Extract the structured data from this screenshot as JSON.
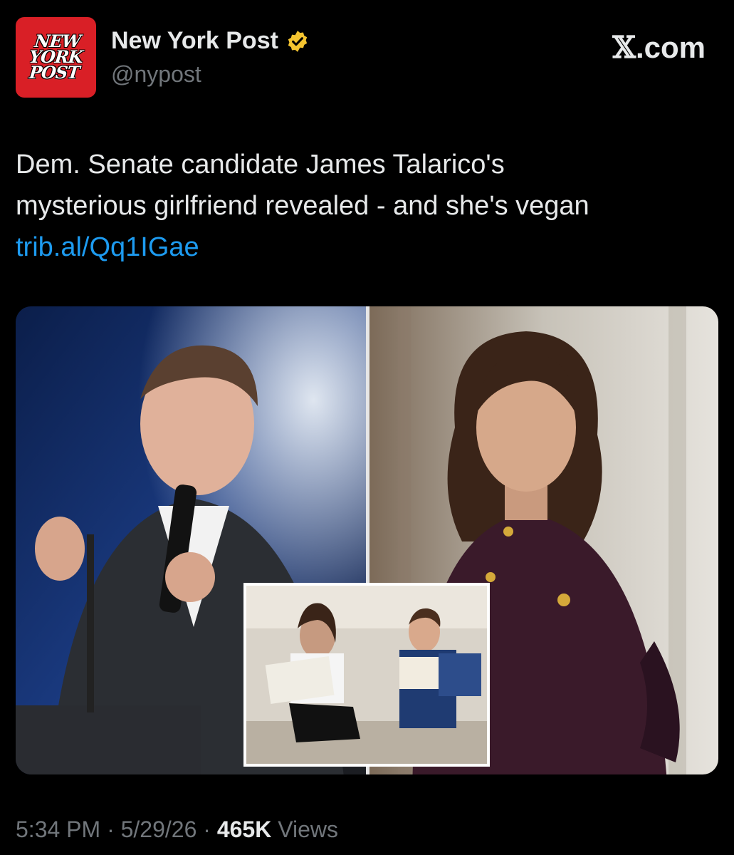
{
  "account": {
    "logo_lines": [
      "NEW",
      "YORK",
      "POST"
    ],
    "display_name": "New York Post",
    "handle": "@nypost",
    "verified_color": "#f4c430",
    "brand_color": "#d91f26"
  },
  "watermark": {
    "x_glyph": "𝕏",
    "text": ".com"
  },
  "post": {
    "text_line1": "Dem. Senate candidate James Talarico's",
    "text_line2": "mysterious girlfriend revealed - and she's vegan",
    "link": "trib.al/Qq1IGae"
  },
  "media": {
    "left_photo": "man-speaking-at-microphone-photo",
    "right_photo": "smiling-woman-portrait-photo",
    "inset_photo": "couple-reading-books-on-floor-photo"
  },
  "footer": {
    "time": "5:34 PM",
    "separator": "·",
    "date": "5/29/26",
    "views_count": "465K",
    "views_label": "Views"
  },
  "colors": {
    "link": "#1d9bf0",
    "muted": "#71767b",
    "text": "#e7e9ea"
  }
}
